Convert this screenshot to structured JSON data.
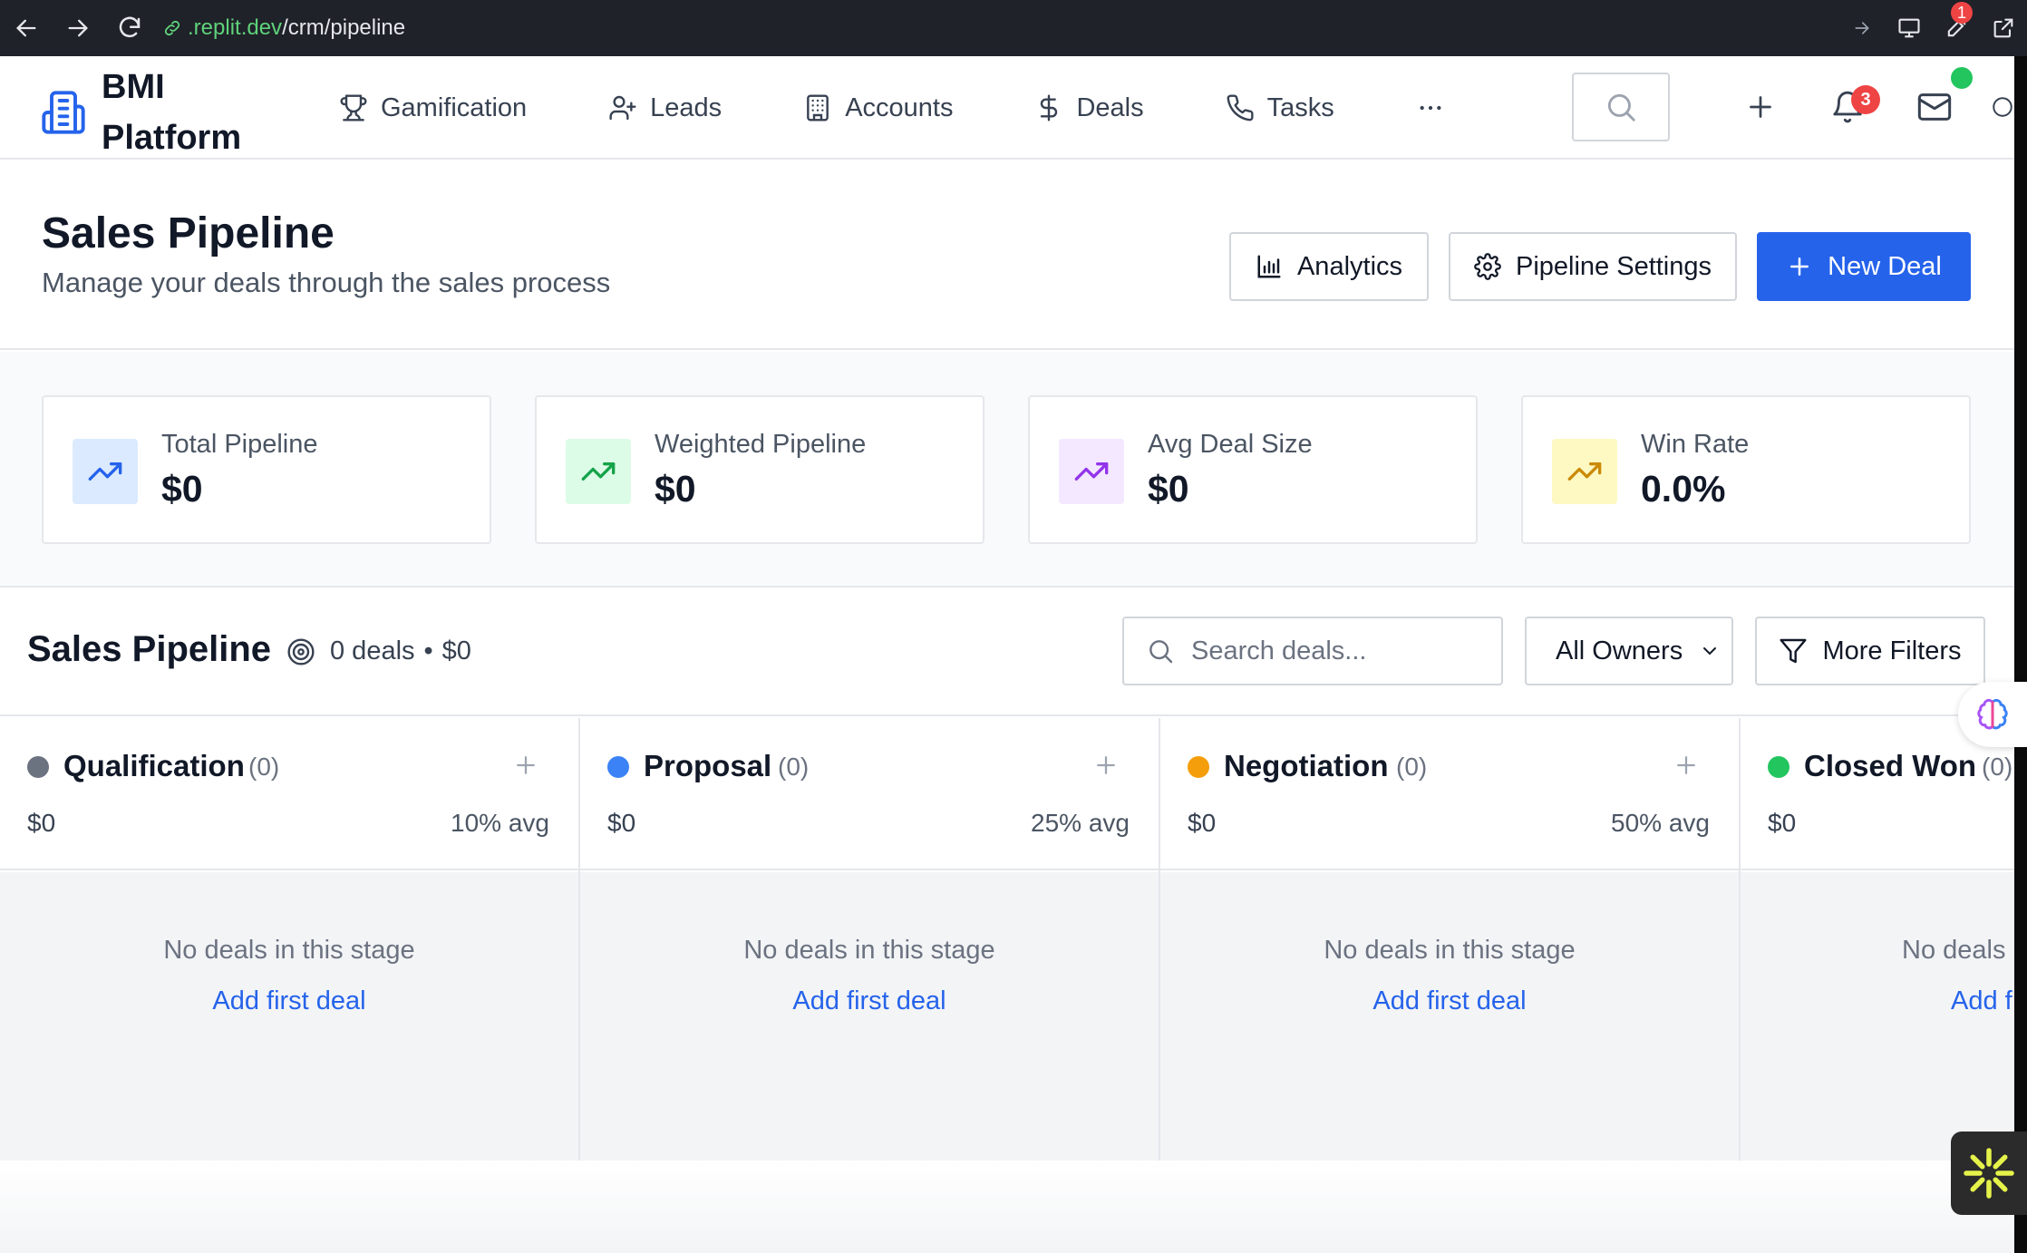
{
  "browser": {
    "url_host": ".replit.dev",
    "url_path": "/crm/pipeline",
    "extension_badge": "1"
  },
  "header": {
    "brand_name": "BMI Platform",
    "nav": [
      {
        "label": "Gamification",
        "icon": "trophy-icon"
      },
      {
        "label": "Leads",
        "icon": "user-plus-icon"
      },
      {
        "label": "Accounts",
        "icon": "building-icon"
      },
      {
        "label": "Deals",
        "icon": "dollar-icon"
      },
      {
        "label": "Tasks",
        "icon": "phone-icon"
      }
    ],
    "notification_count": "3"
  },
  "page": {
    "title": "Sales Pipeline",
    "subtitle": "Manage your deals through the sales process",
    "analytics_label": "Analytics",
    "settings_label": "Pipeline Settings",
    "new_deal_label": "New Deal"
  },
  "stats": [
    {
      "label": "Total Pipeline",
      "value": "$0",
      "color": "#2563eb",
      "bg": "#dbeafe"
    },
    {
      "label": "Weighted Pipeline",
      "value": "$0",
      "color": "#16a34a",
      "bg": "#dcfce7"
    },
    {
      "label": "Avg Deal Size",
      "value": "$0",
      "color": "#9333ea",
      "bg": "#f3e8ff"
    },
    {
      "label": "Win Rate",
      "value": "0.0%",
      "color": "#ca8a04",
      "bg": "#fef9c3"
    }
  ],
  "pipeline": {
    "title": "Sales Pipeline",
    "deals_count": "0 deals",
    "deals_total": "$0",
    "search_placeholder": "Search deals...",
    "owner_filter": "All Owners",
    "more_filters_label": "More Filters",
    "stages": [
      {
        "name": "Qualification",
        "count": "(0)",
        "amount": "$0",
        "avg": "10% avg",
        "color": "#6b7280",
        "empty": "No deals in this stage",
        "cta": "Add first deal"
      },
      {
        "name": "Proposal",
        "count": "(0)",
        "amount": "$0",
        "avg": "25% avg",
        "color": "#3b82f6",
        "empty": "No deals in this stage",
        "cta": "Add first deal"
      },
      {
        "name": "Negotiation",
        "count": "(0)",
        "amount": "$0",
        "avg": "50% avg",
        "color": "#f59e0b",
        "empty": "No deals in this stage",
        "cta": "Add first deal"
      },
      {
        "name": "Closed Won",
        "count": "(0)",
        "amount": "$0",
        "avg": "",
        "color": "#22c55e",
        "empty": "No deals",
        "cta": "Add f"
      }
    ]
  }
}
